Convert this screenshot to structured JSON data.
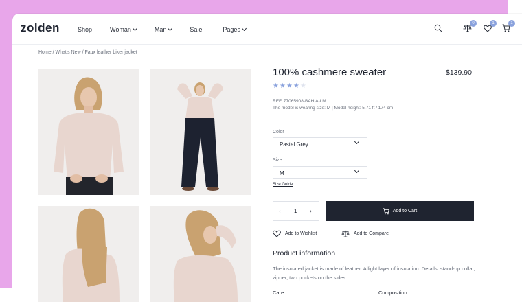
{
  "brand": {
    "logo": "zolden"
  },
  "nav": [
    {
      "label": "Shop",
      "has_dropdown": false
    },
    {
      "label": "Woman",
      "has_dropdown": true
    },
    {
      "label": "Man",
      "has_dropdown": true
    },
    {
      "label": "Sale",
      "has_dropdown": false
    },
    {
      "label": "Pages",
      "has_dropdown": true
    }
  ],
  "header_icons": {
    "search": "search-icon",
    "compare": {
      "icon": "scale-icon",
      "count": "0"
    },
    "wishlist": {
      "icon": "heart-icon",
      "count": "1"
    },
    "cart": {
      "icon": "cart-icon",
      "count": "1"
    }
  },
  "breadcrumb": "Home /  What's New / Faux leather biker jacket",
  "product": {
    "title": "100% cashmere sweater",
    "price": "$139.90",
    "rating_filled": 4,
    "rating_max": 5,
    "ref": "REF. 77065908-BAHIA-LM",
    "model_info": "The model is wearing size: M | Model height: 5.71 ft / 174 cm",
    "color_label": "Color",
    "color_value": "Pastel Grey",
    "size_label": "Size",
    "size_value": "M",
    "size_guide": "Size Guide",
    "quantity": "1",
    "add_to_cart": "Add to Cart",
    "add_to_wishlist": "Add to Wishlist",
    "add_to_compare": "Add to Compare",
    "info_title": "Product information",
    "description": "The insulated jacket is made of leather. A light layer of insulation. Details: stand-up collar, zipper, two pockets on the sides.",
    "care_label": "Care:",
    "composition_label": "Composition:"
  },
  "colors": {
    "accent": "#8aa2dd",
    "dark": "#1f2430",
    "pink_bg": "#e8a6ea",
    "star": "#8aa2dd"
  }
}
